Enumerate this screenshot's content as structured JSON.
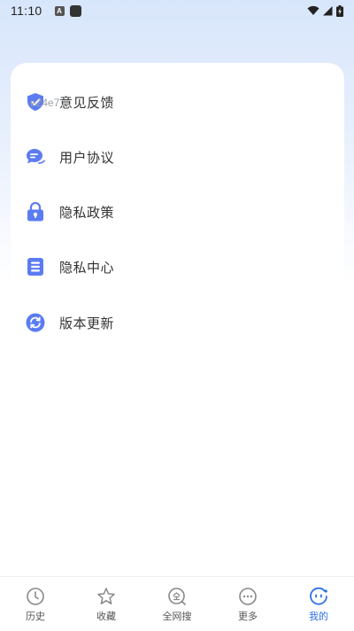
{
  "status_bar": {
    "time": "11:10",
    "badge_letter": "A"
  },
  "overlay_text": "e24e7",
  "menu": [
    {
      "label": "意见反馈",
      "icon": "shield-icon"
    },
    {
      "label": "用户协议",
      "icon": "chat-icon"
    },
    {
      "label": "隐私政策",
      "icon": "lock-icon"
    },
    {
      "label": "隐私中心",
      "icon": "list-icon"
    },
    {
      "label": "版本更新",
      "icon": "refresh-icon"
    }
  ],
  "tabs": [
    {
      "label": "历史",
      "icon": "clock-icon",
      "active": false
    },
    {
      "label": "收藏",
      "icon": "star-icon",
      "active": false
    },
    {
      "label": "全网搜",
      "icon": "search-all-icon",
      "active": false
    },
    {
      "label": "更多",
      "icon": "more-icon",
      "active": false
    },
    {
      "label": "我的",
      "icon": "profile-icon",
      "active": true
    }
  ],
  "colors": {
    "accent": "#5b7cf2",
    "tab_active": "#2f6fe6",
    "tab_inactive": "#888888"
  }
}
